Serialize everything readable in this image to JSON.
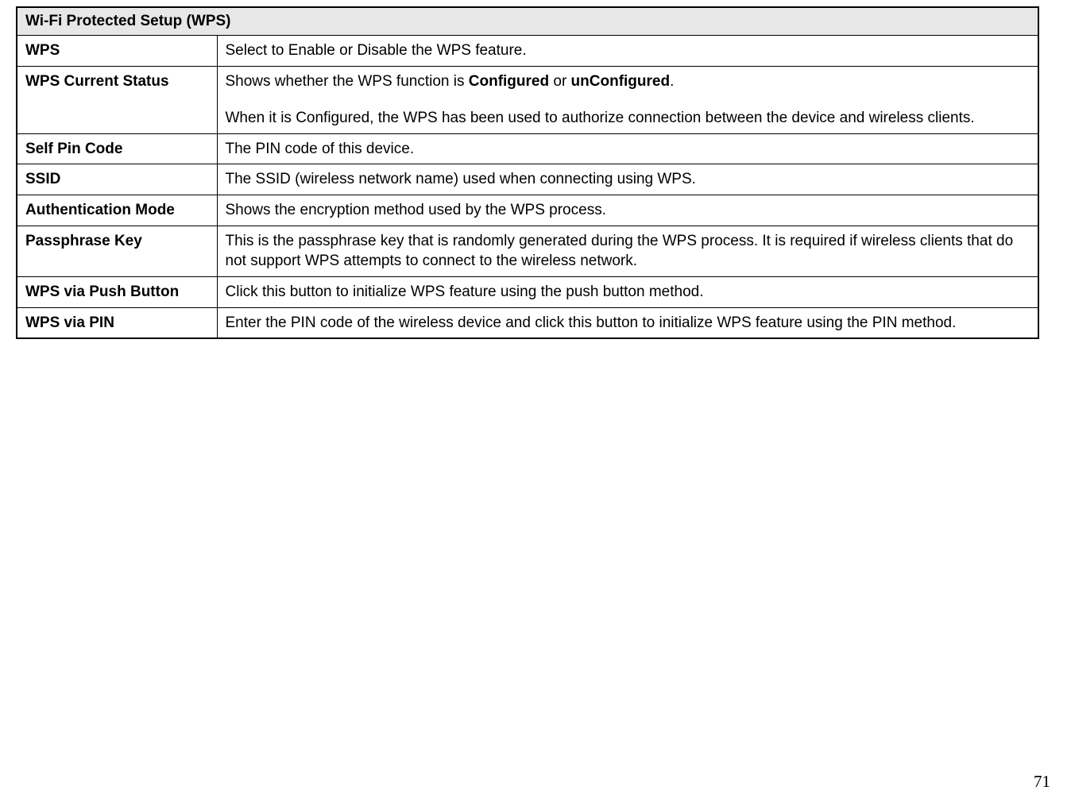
{
  "table": {
    "header": "Wi-Fi Protected Setup (WPS)",
    "rows": [
      {
        "label": "WPS",
        "desc": "Select to Enable or Disable the WPS feature."
      },
      {
        "label": "WPS Current Status",
        "desc": "Shows whether the WPS function is <b>Configured</b> or <b>unConfigured</b>.<span class=\"para-gap\"></span>When it is Configured, the WPS has been used to authorize connection between the device and wireless clients."
      },
      {
        "label": "Self Pin Code",
        "desc": "The PIN code of this device."
      },
      {
        "label": "SSID",
        "desc": "The SSID (wireless network name) used when connecting using WPS."
      },
      {
        "label": "Authentication Mode",
        "desc": "Shows the encryption method used by the WPS process."
      },
      {
        "label": "Passphrase Key",
        "desc": "This is the passphrase key that is randomly generated during the WPS process. It is required if wireless clients that do not support WPS attempts to connect to the wireless network."
      },
      {
        "label": "WPS via Push Button",
        "desc": "Click this button to initialize WPS feature using the push button method."
      },
      {
        "label": "WPS via PIN",
        "desc": "Enter the PIN code of the wireless device and click this button to initialize WPS feature using the PIN method."
      }
    ]
  },
  "page_number": "71"
}
